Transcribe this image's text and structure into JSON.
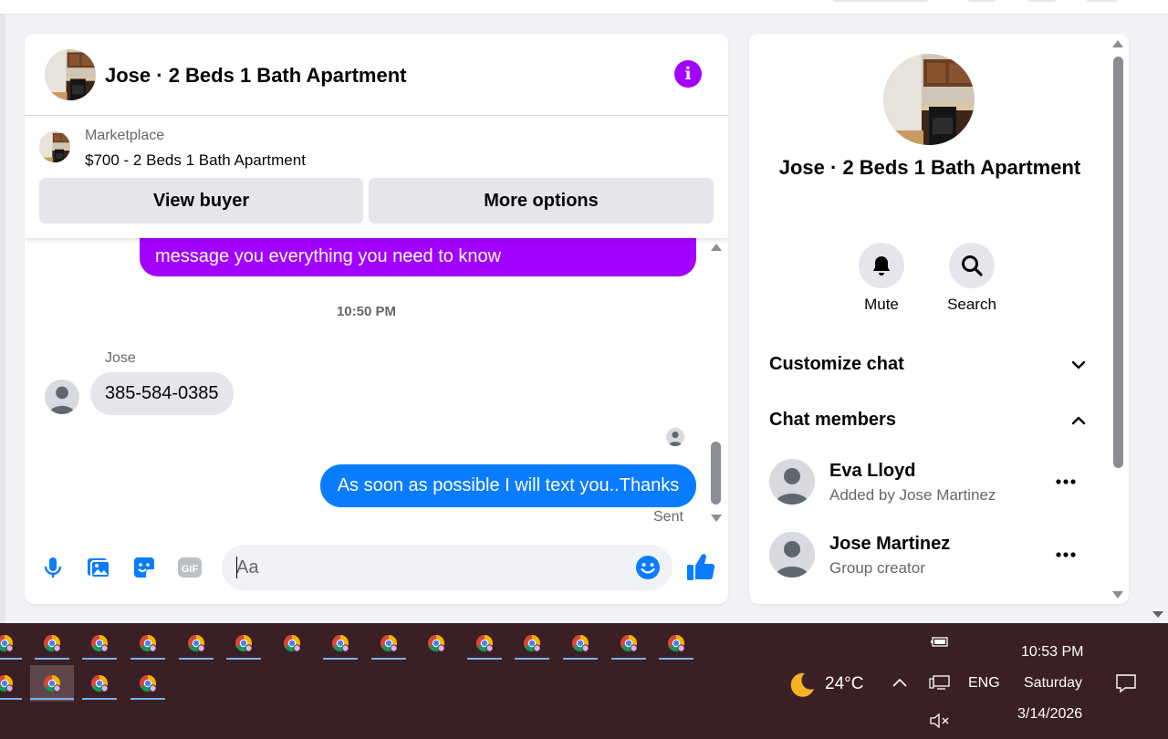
{
  "chat": {
    "title": "Jose · 2 Beds 1 Bath Apartment",
    "marketplace": {
      "label": "Marketplace",
      "listing": "$700 - 2 Beds 1 Bath Apartment",
      "view_buyer": "View buyer",
      "more_options": "More options"
    },
    "messages": [
      {
        "from": "me",
        "text": "message you everything you need to know"
      },
      {
        "type": "timestamp",
        "text": "10:50 PM"
      },
      {
        "from": "Jose",
        "sender_label": "Jose",
        "text": "385-584-0385"
      },
      {
        "from": "me",
        "text": "As soon as possible I will text you..Thanks",
        "status": "Sent"
      }
    ],
    "composer": {
      "placeholder": "Aa"
    }
  },
  "panel": {
    "title": "Jose · 2 Beds 1 Bath Apartment",
    "actions": [
      {
        "label": "Mute",
        "icon": "bell-icon"
      },
      {
        "label": "Search",
        "icon": "search-icon"
      }
    ],
    "sections": {
      "customize": "Customize chat",
      "members": "Chat members"
    },
    "members": [
      {
        "name": "Eva Lloyd",
        "subtitle": "Added by Jose Martinez"
      },
      {
        "name": "Jose Martinez",
        "subtitle": "Group creator"
      }
    ]
  },
  "taskbar": {
    "weather": {
      "temp": "24°C",
      "icon": "moon-icon"
    },
    "language": "ENG",
    "time": "10:53 PM",
    "day": "Saturday",
    "date": "3/14/2026"
  },
  "colors": {
    "accent_purple": "#a200ff",
    "messenger_blue": "#0a7cff",
    "bubble_gray": "#e4e6eb",
    "taskbar": "#3a1f24"
  }
}
